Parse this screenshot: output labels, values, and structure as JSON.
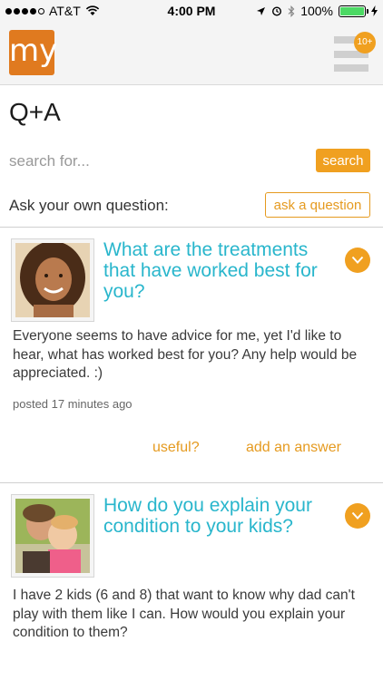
{
  "status_bar": {
    "carrier": "AT&T",
    "time": "4:00 PM",
    "battery": "100%",
    "battery_level": 1.0,
    "signal_bars": 4
  },
  "header": {
    "logo_text": "my",
    "notification_count": "10+",
    "menu_icon": "hamburger-icon"
  },
  "page": {
    "title": "Q+A"
  },
  "search": {
    "placeholder": "search for...",
    "value": "",
    "button_label": "search"
  },
  "ask": {
    "label": "Ask your own question:",
    "button_label": "ask a question"
  },
  "questions": [
    {
      "title": "What are the treatments that have worked best for you?",
      "body": "Everyone seems to have advice for me, yet I'd like to hear, what has worked best for you? Any help would be appreciated. :)",
      "posted": "posted 17 minutes ago",
      "useful_label": "useful?",
      "answer_label": "add an answer"
    },
    {
      "title": "How do you explain your condition to your kids?",
      "body": "I have 2 kids (6 and 8) that want to know why dad can't play with them like I can. How would you explain your condition to them?"
    }
  ],
  "colors": {
    "accent_orange": "#f0a020",
    "title_teal": "#29b6cc",
    "logo_orange": "#e07a1f"
  }
}
